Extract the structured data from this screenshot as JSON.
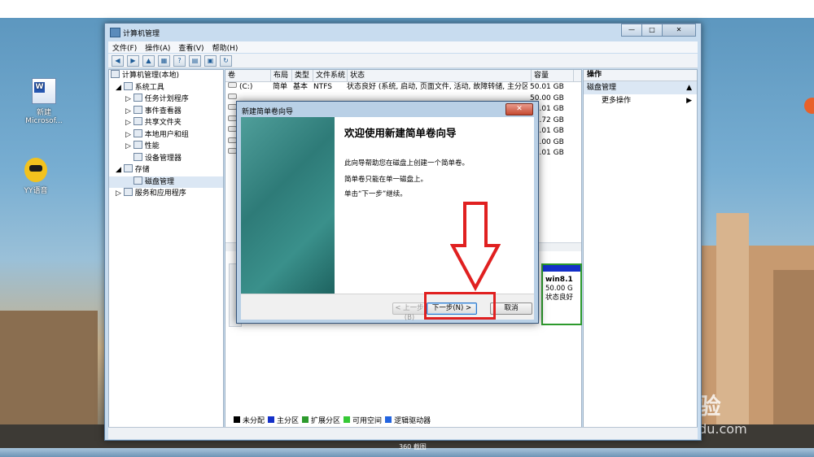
{
  "desktop": {
    "icons": [
      {
        "name": "word-doc",
        "label": "新建\nMicrosof..."
      },
      {
        "name": "yy-voice",
        "label": "YY语音"
      }
    ],
    "watermark": {
      "brand": "Bai 经验",
      "url": "jingyan.baidu.com"
    }
  },
  "window": {
    "title": "计算机管理",
    "buttons": {
      "min": "—",
      "max": "□",
      "close": "✕"
    },
    "menu": [
      "文件(F)",
      "操作(A)",
      "查看(V)",
      "帮助(H)"
    ],
    "tree": [
      {
        "label": "计算机管理(本地)",
        "indent": 0
      },
      {
        "label": "系统工具",
        "indent": 1
      },
      {
        "label": "任务计划程序",
        "indent": 2
      },
      {
        "label": "事件查看器",
        "indent": 2
      },
      {
        "label": "共享文件夹",
        "indent": 2
      },
      {
        "label": "本地用户和组",
        "indent": 2
      },
      {
        "label": "性能",
        "indent": 2
      },
      {
        "label": "设备管理器",
        "indent": 2
      },
      {
        "label": "存储",
        "indent": 1
      },
      {
        "label": "磁盘管理",
        "indent": 2
      },
      {
        "label": "服务和应用程序",
        "indent": 1
      }
    ],
    "volume_table": {
      "headers": [
        "卷",
        "布局",
        "类型",
        "文件系统",
        "状态",
        "容量"
      ],
      "rows": [
        [
          "(C:)",
          "简单",
          "基本",
          "NTFS",
          "状态良好 (系统, 启动, 页面文件, 活动, 故障转储, 主分区)",
          "50.01 GB"
        ],
        [
          "",
          "",
          "",
          "",
          "",
          "50.00 GB"
        ],
        [
          "",
          "",
          "",
          "",
          "",
          "83.01 GB"
        ],
        [
          "",
          "",
          "",
          "",
          "",
          "32.72 GB"
        ],
        [
          "",
          "",
          "",
          "",
          "",
          "84.01 GB"
        ],
        [
          "",
          "",
          "",
          "",
          "",
          "43.00 GB"
        ],
        [
          "",
          "",
          "",
          "",
          "",
          "83.01 GB"
        ]
      ]
    },
    "partition": {
      "name": "win8.1",
      "size": "50.00 G",
      "status": "状态良好"
    },
    "legend": [
      {
        "label": "未分配",
        "color": "#000000"
      },
      {
        "label": "主分区",
        "color": "#1430c8"
      },
      {
        "label": "扩展分区",
        "color": "#2d9a2d"
      },
      {
        "label": "可用空间",
        "color": "#36c936"
      },
      {
        "label": "逻辑驱动器",
        "color": "#2264e0"
      }
    ],
    "actions": {
      "header": "操作",
      "selected": "磁盘管理",
      "more": "更多操作"
    }
  },
  "dialog": {
    "title": "新建简单卷向导",
    "heading": "欢迎使用新建简单卷向导",
    "lines": [
      "此向导帮助您在磁盘上创建一个简单卷。",
      "简单卷只能在单一磁盘上。",
      "单击“下一步”继续。"
    ],
    "back": "< 上一步(B)",
    "next": "下一步(N) >",
    "cancel": "取消",
    "close": "✕"
  },
  "taskbar_text": "360 截图"
}
